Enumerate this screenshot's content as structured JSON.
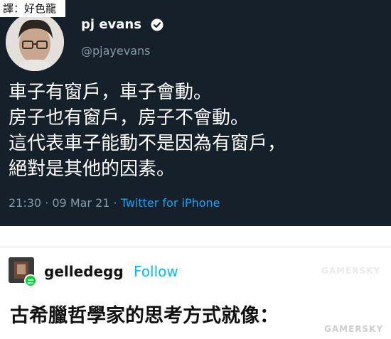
{
  "translator_note": "譯：好色龍",
  "tweet": {
    "display_name": "pj evans",
    "handle": "@pjayevans",
    "lines": [
      "車子有窗戶，車子會動。",
      "房子也有窗戶，房子不會動。",
      "這代表車子能動不是因為有窗戶，",
      "絕對是其他的因素。"
    ],
    "timestamp": "21:30 · 09 Mar 21 · ",
    "source": "Twitter for iPhone"
  },
  "post": {
    "username": "gelledegg",
    "follow_label": "Follow",
    "text": "古希臘哲學家的思考方式就像："
  },
  "watermark": "GAMERSKY",
  "colors": {
    "tweet_background": "#15202b",
    "tweet_text": "#ffffff",
    "muted_text": "#8899a6",
    "twitter_link": "#1da1f2",
    "follow_link": "#00b8ff",
    "reblog_green": "#00cf35"
  }
}
